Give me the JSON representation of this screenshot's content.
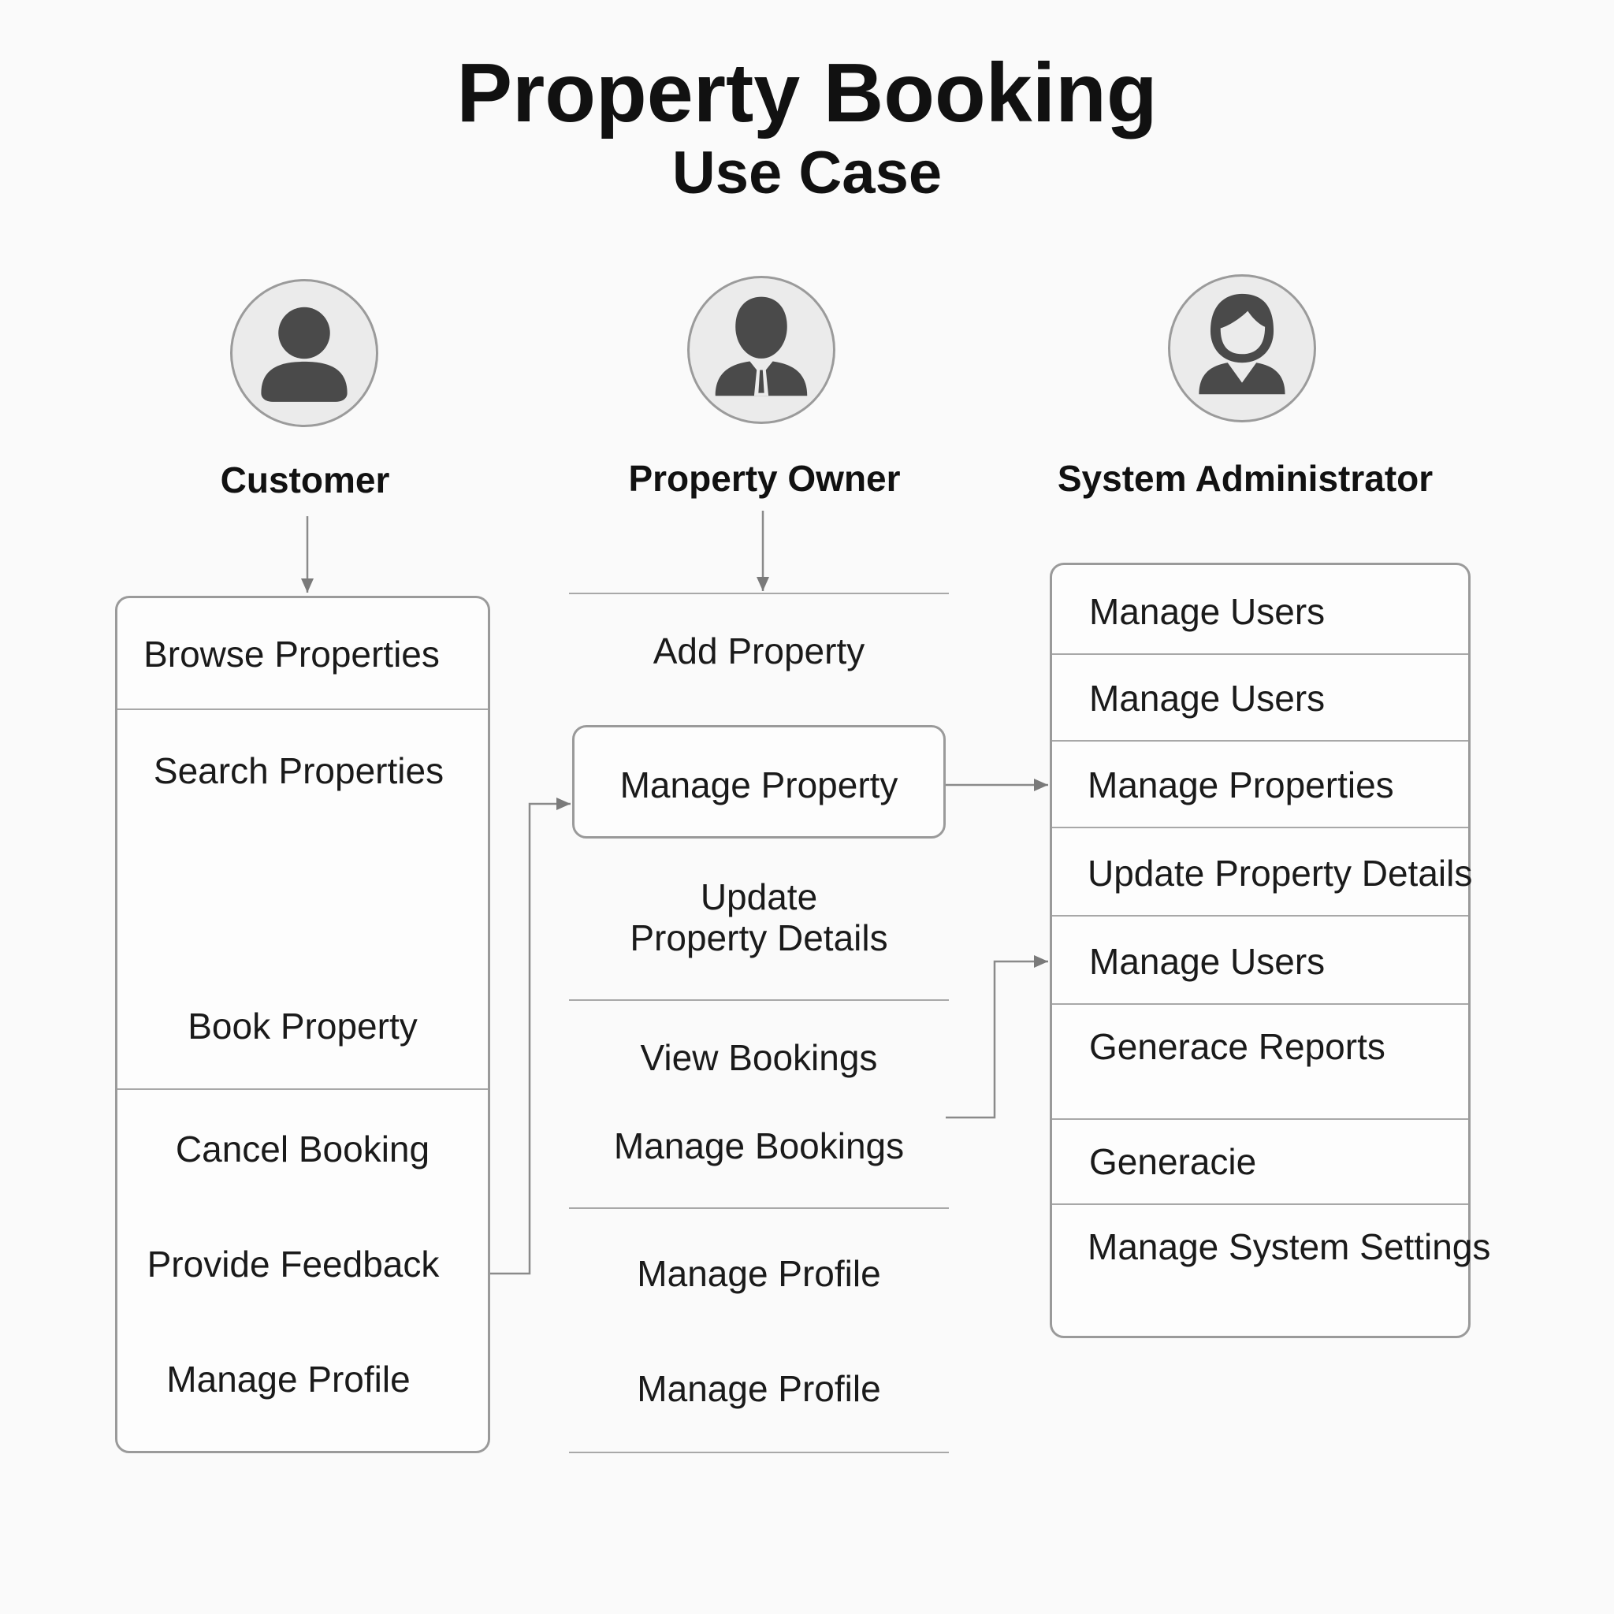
{
  "title": "Property Booking",
  "subtitle": "Use Case",
  "actors": {
    "customer": {
      "label": "Customer",
      "icon": "user-icon"
    },
    "owner": {
      "label": "Property Owner",
      "icon": "businessman-icon"
    },
    "admin": {
      "label": "System Administrator",
      "icon": "administrator-icon"
    }
  },
  "customer_items": [
    "Browse Properties",
    "Search Properties",
    "Book Property",
    "Cancel Booking",
    "Provide Feedback",
    "Manage Profile"
  ],
  "owner_items": {
    "add_property": "Add Property",
    "manage_property": "Manage Property",
    "update_line1": "Update",
    "update_line2": "Property Details",
    "view_bookings": "View Bookings",
    "manage_bookings": "Manage Bookings",
    "manage_profile_1": "Manage Profile",
    "manage_profile_2": "Manage Profile"
  },
  "admin_items": [
    "Manage Users",
    "Manage Users",
    "Manage Properties",
    "Update Property Details",
    "Manage Users",
    "Generace Reports",
    "Generacie",
    "Manage System Settings"
  ],
  "colors": {
    "line": "#8a8a8a",
    "avatar_fill": "#4a4a4a",
    "avatar_bg": "#ebebeb"
  }
}
